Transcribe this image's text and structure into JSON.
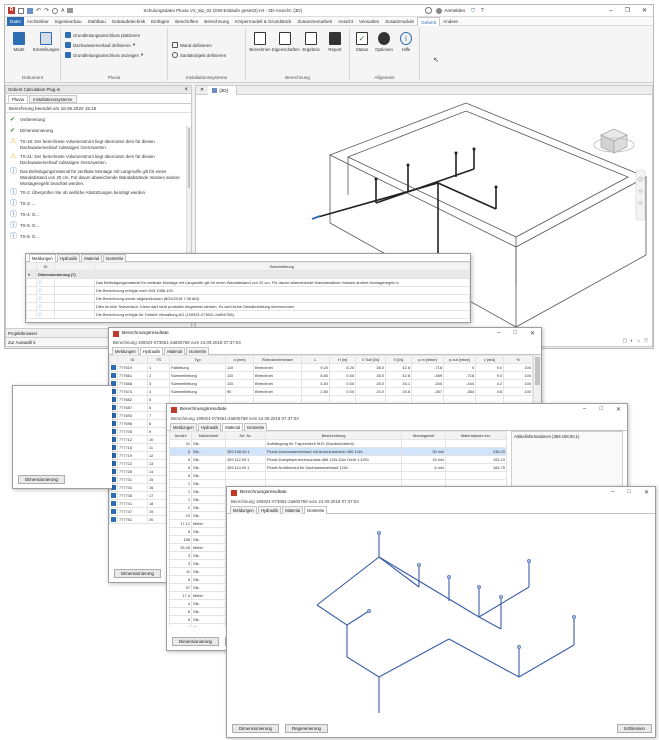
{
  "titlebar": {
    "file_label": "Schulungsdatei Pluvia V2_sip_02 (DW-Einläufe gesetzt).rvt - 3D-Ansicht: {3D}",
    "signin": "Anmelden",
    "help": "?"
  },
  "menus": [
    "Datei",
    "Architektur",
    "Ingenieurbau",
    "Stahlbau",
    "Gebäudetechnik",
    "Einfügen",
    "Beschriften",
    "Berechnung",
    "Körpermodell & Grundstück",
    "Zusammenarbeit",
    "Ansicht",
    "Verwalten",
    "Zusatzmodule",
    "Geberit",
    "Andere"
  ],
  "menu_selected": "Geberit",
  "ribbon": {
    "groups": {
      "dokument": "Dokument",
      "pluvia": "Pluvia",
      "install": "Installationssysteme",
      "berechnung": "Berechnung",
      "allgemein": "Allgemein"
    },
    "buttons": {
      "markt": "Markt",
      "einstellungen": "Einstellungen",
      "grundleitung": "Grundleitungsanschluss platzieren",
      "dachwasser": "Dachwasserverlauf definieren",
      "grundleitung_anzeigen": "Grundleitungsanschluss anzeigen",
      "wand": "Wand definieren",
      "sanitaer": "Sanitärobjekt definieren",
      "berechnen": "Berechnen",
      "eigenschaften": "Eigenschaften",
      "ergebnis": "Ergebnis",
      "report": "Report",
      "status": "Status",
      "optionen": "Optionen",
      "hilfe": "Hilfe"
    }
  },
  "plugin": {
    "header": "Geberit Calculation Plug-in",
    "close": "×",
    "tabs": [
      "Pluvia",
      "Installationssysteme"
    ],
    "status": "Berechnung beendet um 18.05.2020 15:15",
    "messages": [
      {
        "type": "ok",
        "text": "Vorbereitung"
      },
      {
        "type": "ok",
        "text": "Dimensionierung"
      },
      {
        "type": "warn",
        "text": "TS-18: Der berechnete Volumenstrom liegt über/unter dem für diesen Dachwasserverlauf zulässigen Grenzwerten."
      },
      {
        "type": "warn",
        "text": "TS-21: Der berechnete Volumenstrom liegt über/unter dem für diesen Dachwasserverlauf zulässigen Grenzwerten."
      },
      {
        "type": "info",
        "text": "Das Befestigungsmaterial für vertikale Montage mit Langmuffe gilt für einen Wandabstand von 20 cm. Für davon abweichende Wandabstände müssen andere Montageregeln beachtet werden."
      },
      {
        "type": "info",
        "text": "TS-2: Überprüfen Sie ob seitliche Abstützungen benötigt werden."
      },
      {
        "type": "info",
        "text": "TS-3: ..."
      },
      {
        "type": "info",
        "text": "TS-4: G..."
      },
      {
        "type": "info",
        "text": "TS-5: G..."
      },
      {
        "type": "info",
        "text": "TS-6: G..."
      }
    ],
    "footer1": "Projektbrowser",
    "footer2": "Zur Auswahl k"
  },
  "view3d": {
    "tab": "{3D}"
  },
  "msgwin": {
    "tabs": [
      "Meldungen",
      "Hydraulik",
      "Material",
      "Isometrie"
    ],
    "col_id": "ID",
    "col_desc": "Beschreibung",
    "group": "Dimensionierung (7)",
    "rows": [
      "Das Befestigungsmaterial für vertikale Montage mit Langmuffe gilt für einen Wandabstand von 20 cm. Für davon abweichende Wandabstände müssen andere Montageregeln b",
      "Die Berechnung erfolgte nach DIN 1986-100.",
      "Die Berechnung wurde abgeschlossen (8/24/2018 7:38 AM).",
      "Dies ist eine Testversion. Diese darf nicht produktiv eingesetzt werden. Es wird keine Gewährleistung übernommen.",
      "Die Berechnung erfolgte für Geberit Verwaltung AG (190924-073651-2a800768)."
    ]
  },
  "hydraulik": {
    "title": "Berechnungsresultate",
    "subtitle": "Berechnung 190924-073651-2a800768 vom 24.09.2018 07:37:03",
    "tabs": [
      "Meldungen",
      "Hydraulik",
      "Material",
      "Isometrie"
    ],
    "headers": [
      "ID",
      "TS",
      "Typ",
      "d [mm]",
      "Rohrdurchmesser",
      "L",
      "H [m]",
      "V Soll [l/s]",
      "V [l/s]",
      "p.m [mbar]",
      "p.out [mbar]",
      "v [m/s]",
      "%"
    ],
    "rows": [
      [
        "777619",
        "1",
        "Fallleitung",
        "110",
        "Berechnet",
        "9.20",
        "8.20",
        "38.0",
        "42.8",
        "-718",
        "0",
        "9.0",
        "100"
      ],
      [
        "777661",
        "2",
        "Sammelleitung",
        "110",
        "Berechnet",
        "8.80",
        "0.00",
        "38.0",
        "42.8",
        "-489",
        "-718",
        "9.0",
        "100"
      ],
      [
        "777668",
        "3",
        "Sammelleitung",
        "110",
        "Berechnet",
        "4.50",
        "0.00",
        "28.0",
        "34.1",
        "-340",
        "-444",
        "4.2",
        "100"
      ],
      [
        "777674",
        "4",
        "Sammelleitung",
        "90",
        "Berechnet",
        "2.80",
        "0.00",
        "20.0",
        "25.8",
        "-267",
        "-384",
        "4.8",
        "100"
      ],
      [
        "777682",
        "5",
        "",
        "",
        "",
        "",
        "",
        "",
        "",
        "",
        "",
        "",
        ""
      ],
      [
        "777687",
        "6",
        "",
        "",
        "",
        "",
        "",
        "",
        "",
        "",
        "",
        "",
        ""
      ],
      [
        "777693",
        "7",
        "",
        "",
        "",
        "",
        "",
        "",
        "",
        "",
        "",
        "",
        ""
      ],
      [
        "777696",
        "8",
        "",
        "",
        "",
        "",
        "",
        "",
        "",
        "",
        "",
        "",
        ""
      ],
      [
        "777705",
        "9",
        "",
        "",
        "",
        "",
        "",
        "",
        "",
        "",
        "",
        "",
        ""
      ],
      [
        "777712",
        "10",
        "",
        "",
        "",
        "",
        "",
        "",
        "",
        "",
        "",
        "",
        ""
      ],
      [
        "777716",
        "11",
        "",
        "",
        "",
        "",
        "",
        "",
        "",
        "",
        "",
        "",
        ""
      ],
      [
        "777719",
        "12",
        "",
        "",
        "",
        "",
        "",
        "",
        "",
        "",
        "",
        "",
        ""
      ],
      [
        "777722",
        "13",
        "",
        "",
        "",
        "",
        "",
        "",
        "",
        "",
        "",
        "",
        ""
      ],
      [
        "777728",
        "14",
        "",
        "",
        "",
        "",
        "",
        "",
        "",
        "",
        "",
        "",
        ""
      ],
      [
        "777731",
        "15",
        "",
        "",
        "",
        "",
        "",
        "",
        "",
        "",
        "",
        "",
        ""
      ],
      [
        "777734",
        "16",
        "",
        "",
        "",
        "",
        "",
        "",
        "",
        "",
        "",
        "",
        ""
      ],
      [
        "777738",
        "17",
        "",
        "",
        "",
        "",
        "",
        "",
        "",
        "",
        "",
        "",
        ""
      ],
      [
        "777741",
        "18",
        "",
        "",
        "",
        "",
        "",
        "",
        "",
        "",
        "",
        "",
        ""
      ],
      [
        "777747",
        "19",
        "",
        "",
        "",
        "",
        "",
        "",
        "",
        "",
        "",
        "",
        ""
      ],
      [
        "777751",
        "20",
        "",
        "",
        "",
        "",
        "",
        "",
        "",
        "",
        "",
        "",
        ""
      ]
    ],
    "btn_dim": "Dimensionierung",
    "btn_re": "Regenerierung"
  },
  "material": {
    "title": "Berechnungsresultate",
    "subtitle": "Berechnung 190924-073651-2a800768 vom 24.09.2018 07:37:03",
    "tabs": [
      "Meldungen",
      "Hydraulik",
      "Material",
      "Isometrie"
    ],
    "headers": [
      "Anzahl",
      "Maßeinheit",
      "Art.-Nr.",
      "Beschreibung",
      "Montagezeit",
      "Materialpreis exv."
    ],
    "side": "Artikelinformationen (359.108.00.1)",
    "rows": [
      [
        "31",
        "Stk.",
        "",
        "Aufhängung für Trapezblech M10 (Sandwichblech)",
        "",
        ""
      ],
      [
        "5",
        "Stk.",
        "359.108.00.1",
        "Pluvia Dachwassereinlauf mit Anschlussblech d56 12l/s",
        "30 min",
        "236.20"
      ],
      [
        "5",
        "Stk.",
        "359.112.00.1",
        "Pluvia Dampfsperrenanschluss d56 12l/s DAn Dicht 1:4201",
        "15 min",
        "152.10"
      ],
      [
        "5",
        "Stk.",
        "359.114.00.1",
        "Pluvia Notüberlauf für Dachwassereinlauf 12l/s",
        "6 min",
        "184.70"
      ],
      [
        "5",
        "Stk.",
        "",
        "",
        "",
        ""
      ],
      [
        "1",
        "Stk.",
        "",
        "",
        "",
        ""
      ],
      [
        "1",
        "Stk.",
        "",
        "",
        "",
        ""
      ],
      [
        "1",
        "Stk.",
        "",
        "",
        "",
        ""
      ],
      [
        "2",
        "Stk.",
        "",
        "",
        "",
        ""
      ],
      [
        "23",
        "Stk.",
        "",
        "",
        "",
        ""
      ],
      [
        "17.12",
        "Meter",
        "",
        "",
        "",
        ""
      ],
      [
        "8",
        "Stk.",
        "",
        "",
        "",
        ""
      ],
      [
        "158",
        "Stk.",
        "",
        "",
        "",
        ""
      ],
      [
        "25.45",
        "Meter",
        "",
        "",
        "",
        ""
      ],
      [
        "3",
        "Stk.",
        "",
        "",
        "",
        ""
      ],
      [
        "3",
        "Stk.",
        "",
        "",
        "",
        ""
      ],
      [
        "11",
        "Stk.",
        "",
        "",
        "",
        ""
      ],
      [
        "8",
        "Stk.",
        "",
        "",
        "",
        ""
      ],
      [
        "37",
        "Stk.",
        "",
        "",
        "",
        ""
      ],
      [
        "17.4",
        "Meter",
        "",
        "",
        "",
        ""
      ],
      [
        "4",
        "Stk.",
        "",
        "",
        "",
        ""
      ],
      [
        "6",
        "Stk.",
        "",
        "",
        "",
        ""
      ],
      [
        "5",
        "Stk.",
        "",
        "",
        "",
        ""
      ],
      [
        "6",
        "Stk.",
        "",
        "",
        "",
        ""
      ]
    ],
    "btn_dim": "Dimensionierung",
    "btn_re": "Re"
  },
  "isometrie": {
    "title": "Berechnungsresultate",
    "subtitle": "Berechnung 190924-073651-2a800768 vom 24.09.2018 07:37:03",
    "tabs": [
      "Meldungen",
      "Hydraulik",
      "Material",
      "Isometrie"
    ],
    "btn_dim": "Dimensionierung",
    "btn_re": "Regenerierung",
    "btn_close": "Schliessen"
  },
  "colors": {
    "accent": "#2c6db4",
    "pipe": "#3a5da8",
    "warn": "#f2b820",
    "ok": "#2e8b2e",
    "info": "#2c6db4"
  }
}
